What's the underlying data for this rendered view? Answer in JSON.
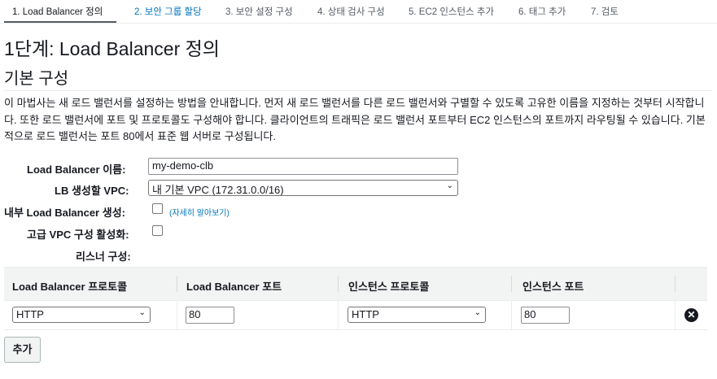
{
  "wizard": {
    "steps": [
      {
        "label": "1. Load Balancer 정의"
      },
      {
        "label": "2. 보안 그룹 할당"
      },
      {
        "label": "3. 보안 설정 구성"
      },
      {
        "label": "4. 상태 검사 구성"
      },
      {
        "label": "5. EC2 인스턴스 추가"
      },
      {
        "label": "6. 태그 추가"
      },
      {
        "label": "7. 검토"
      }
    ],
    "active_step": 1
  },
  "page": {
    "title": "1단계: Load Balancer 정의",
    "section_title": "기본 구성",
    "description": "이 마법사는 새 로드 밸런서를 설정하는 방법을 안내합니다. 먼저 새 로드 밸런서를 다른 로드 밸런서와 구별할 수 있도록 고유한 이름을 지정하는 것부터 시작합니다. 또한 로드 밸런서에 포트 및 프로토콜도 구성해야 합니다. 클라이언트의 트래픽은 로드 밸런서 포트부터 EC2 인스턴스의 포트까지 라우팅될 수 있습니다. 기본적으로 로드 밸런서는 포트 80에서 표준 웹 서버로 구성됩니다."
  },
  "form": {
    "name_label": "Load Balancer 이름:",
    "name_value": "my-demo-clb",
    "vpc_label": "LB 생성할 VPC:",
    "vpc_value": "내 기본 VPC (172.31.0.0/16)",
    "internal_label": "내부 Load Balancer 생성:",
    "internal_checked": false,
    "learn_more": "(자세히 알아보기)",
    "advanced_vpc_label": "고급 VPC 구성 활성화:",
    "advanced_vpc_checked": false,
    "listener_label": "리스너 구성:"
  },
  "listeners": {
    "headers": [
      "Load Balancer 프로토콜",
      "Load Balancer 포트",
      "인스턴스 프로토콜",
      "인스턴스 포트"
    ],
    "rows": [
      {
        "lb_protocol": "HTTP",
        "lb_port": "80",
        "instance_protocol": "HTTP",
        "instance_port": "80"
      }
    ],
    "add_label": "추가"
  },
  "icons": {
    "remove": "close-circle-icon",
    "dropdown": "chevron-down-icon"
  },
  "colors": {
    "link": "#0073bb",
    "header_bg": "#f2f3f3",
    "active_tab": "#16191f"
  }
}
